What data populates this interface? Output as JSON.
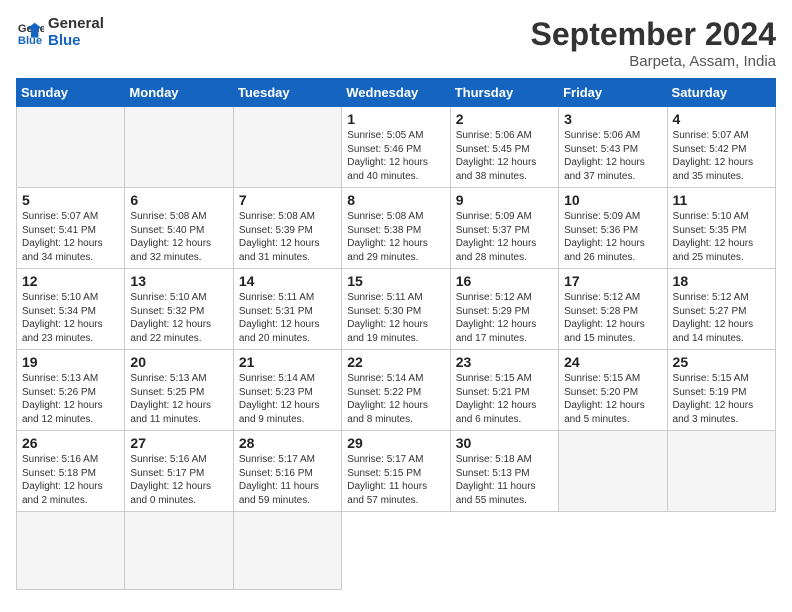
{
  "header": {
    "logo_line1": "General",
    "logo_line2": "Blue",
    "month_title": "September 2024",
    "subtitle": "Barpeta, Assam, India"
  },
  "weekdays": [
    "Sunday",
    "Monday",
    "Tuesday",
    "Wednesday",
    "Thursday",
    "Friday",
    "Saturday"
  ],
  "days": [
    {
      "num": "",
      "info": ""
    },
    {
      "num": "",
      "info": ""
    },
    {
      "num": "",
      "info": ""
    },
    {
      "num": "1",
      "info": "Sunrise: 5:05 AM\nSunset: 5:46 PM\nDaylight: 12 hours\nand 40 minutes."
    },
    {
      "num": "2",
      "info": "Sunrise: 5:06 AM\nSunset: 5:45 PM\nDaylight: 12 hours\nand 38 minutes."
    },
    {
      "num": "3",
      "info": "Sunrise: 5:06 AM\nSunset: 5:43 PM\nDaylight: 12 hours\nand 37 minutes."
    },
    {
      "num": "4",
      "info": "Sunrise: 5:07 AM\nSunset: 5:42 PM\nDaylight: 12 hours\nand 35 minutes."
    },
    {
      "num": "5",
      "info": "Sunrise: 5:07 AM\nSunset: 5:41 PM\nDaylight: 12 hours\nand 34 minutes."
    },
    {
      "num": "6",
      "info": "Sunrise: 5:08 AM\nSunset: 5:40 PM\nDaylight: 12 hours\nand 32 minutes."
    },
    {
      "num": "7",
      "info": "Sunrise: 5:08 AM\nSunset: 5:39 PM\nDaylight: 12 hours\nand 31 minutes."
    },
    {
      "num": "8",
      "info": "Sunrise: 5:08 AM\nSunset: 5:38 PM\nDaylight: 12 hours\nand 29 minutes."
    },
    {
      "num": "9",
      "info": "Sunrise: 5:09 AM\nSunset: 5:37 PM\nDaylight: 12 hours\nand 28 minutes."
    },
    {
      "num": "10",
      "info": "Sunrise: 5:09 AM\nSunset: 5:36 PM\nDaylight: 12 hours\nand 26 minutes."
    },
    {
      "num": "11",
      "info": "Sunrise: 5:10 AM\nSunset: 5:35 PM\nDaylight: 12 hours\nand 25 minutes."
    },
    {
      "num": "12",
      "info": "Sunrise: 5:10 AM\nSunset: 5:34 PM\nDaylight: 12 hours\nand 23 minutes."
    },
    {
      "num": "13",
      "info": "Sunrise: 5:10 AM\nSunset: 5:32 PM\nDaylight: 12 hours\nand 22 minutes."
    },
    {
      "num": "14",
      "info": "Sunrise: 5:11 AM\nSunset: 5:31 PM\nDaylight: 12 hours\nand 20 minutes."
    },
    {
      "num": "15",
      "info": "Sunrise: 5:11 AM\nSunset: 5:30 PM\nDaylight: 12 hours\nand 19 minutes."
    },
    {
      "num": "16",
      "info": "Sunrise: 5:12 AM\nSunset: 5:29 PM\nDaylight: 12 hours\nand 17 minutes."
    },
    {
      "num": "17",
      "info": "Sunrise: 5:12 AM\nSunset: 5:28 PM\nDaylight: 12 hours\nand 15 minutes."
    },
    {
      "num": "18",
      "info": "Sunrise: 5:12 AM\nSunset: 5:27 PM\nDaylight: 12 hours\nand 14 minutes."
    },
    {
      "num": "19",
      "info": "Sunrise: 5:13 AM\nSunset: 5:26 PM\nDaylight: 12 hours\nand 12 minutes."
    },
    {
      "num": "20",
      "info": "Sunrise: 5:13 AM\nSunset: 5:25 PM\nDaylight: 12 hours\nand 11 minutes."
    },
    {
      "num": "21",
      "info": "Sunrise: 5:14 AM\nSunset: 5:23 PM\nDaylight: 12 hours\nand 9 minutes."
    },
    {
      "num": "22",
      "info": "Sunrise: 5:14 AM\nSunset: 5:22 PM\nDaylight: 12 hours\nand 8 minutes."
    },
    {
      "num": "23",
      "info": "Sunrise: 5:15 AM\nSunset: 5:21 PM\nDaylight: 12 hours\nand 6 minutes."
    },
    {
      "num": "24",
      "info": "Sunrise: 5:15 AM\nSunset: 5:20 PM\nDaylight: 12 hours\nand 5 minutes."
    },
    {
      "num": "25",
      "info": "Sunrise: 5:15 AM\nSunset: 5:19 PM\nDaylight: 12 hours\nand 3 minutes."
    },
    {
      "num": "26",
      "info": "Sunrise: 5:16 AM\nSunset: 5:18 PM\nDaylight: 12 hours\nand 2 minutes."
    },
    {
      "num": "27",
      "info": "Sunrise: 5:16 AM\nSunset: 5:17 PM\nDaylight: 12 hours\nand 0 minutes."
    },
    {
      "num": "28",
      "info": "Sunrise: 5:17 AM\nSunset: 5:16 PM\nDaylight: 11 hours\nand 59 minutes."
    },
    {
      "num": "29",
      "info": "Sunrise: 5:17 AM\nSunset: 5:15 PM\nDaylight: 11 hours\nand 57 minutes."
    },
    {
      "num": "30",
      "info": "Sunrise: 5:18 AM\nSunset: 5:13 PM\nDaylight: 11 hours\nand 55 minutes."
    },
    {
      "num": "",
      "info": ""
    },
    {
      "num": "",
      "info": ""
    },
    {
      "num": "",
      "info": ""
    },
    {
      "num": "",
      "info": ""
    },
    {
      "num": "",
      "info": ""
    }
  ]
}
